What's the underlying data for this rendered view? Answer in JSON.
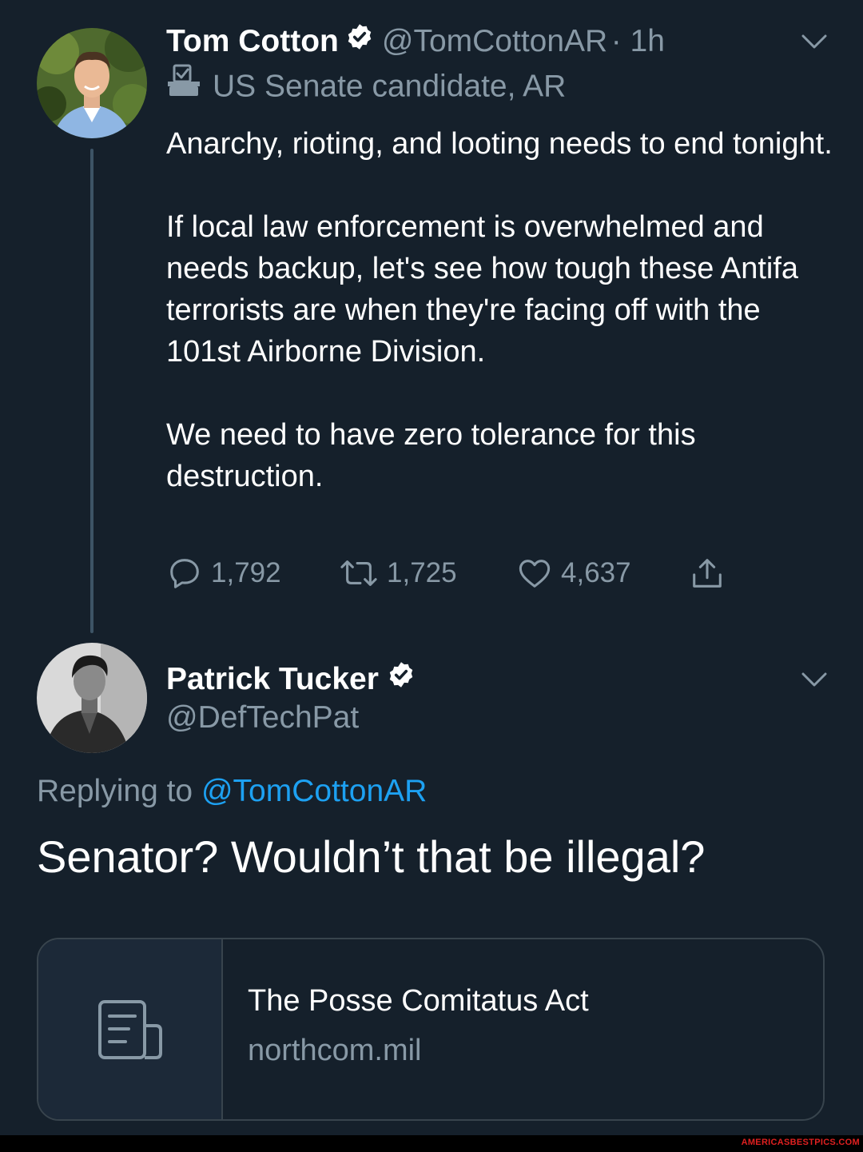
{
  "tweet1": {
    "name": "Tom Cotton",
    "handle": "@TomCottonAR",
    "time": "· 1h",
    "label": "US Senate candidate, AR",
    "paragraphs": [
      "Anarchy, rioting, and looting needs to end tonight.",
      "If local law enforcement is overwhelmed and needs backup, let's see how tough these Antifa terrorists are when they're facing off with the 101st Airborne Division.",
      "We need to have zero tolerance for this destruction."
    ],
    "replies": "1,792",
    "retweets": "1,725",
    "likes": "4,637"
  },
  "tweet2": {
    "name": "Patrick Tucker",
    "handle": "@DefTechPat",
    "replying_prefix": "Replying to",
    "replying_mention": "@TomCottonAR",
    "text": "Senator? Wouldn’t that be illegal?",
    "card": {
      "title": "The Posse Comitatus Act",
      "domain": "northcom.mil"
    }
  },
  "watermark": "AMERICASBESTPICS.COM",
  "colors": {
    "background": "#15202b",
    "secondary_text": "#8899a6",
    "link": "#1da1f2",
    "divider": "#38444d"
  }
}
